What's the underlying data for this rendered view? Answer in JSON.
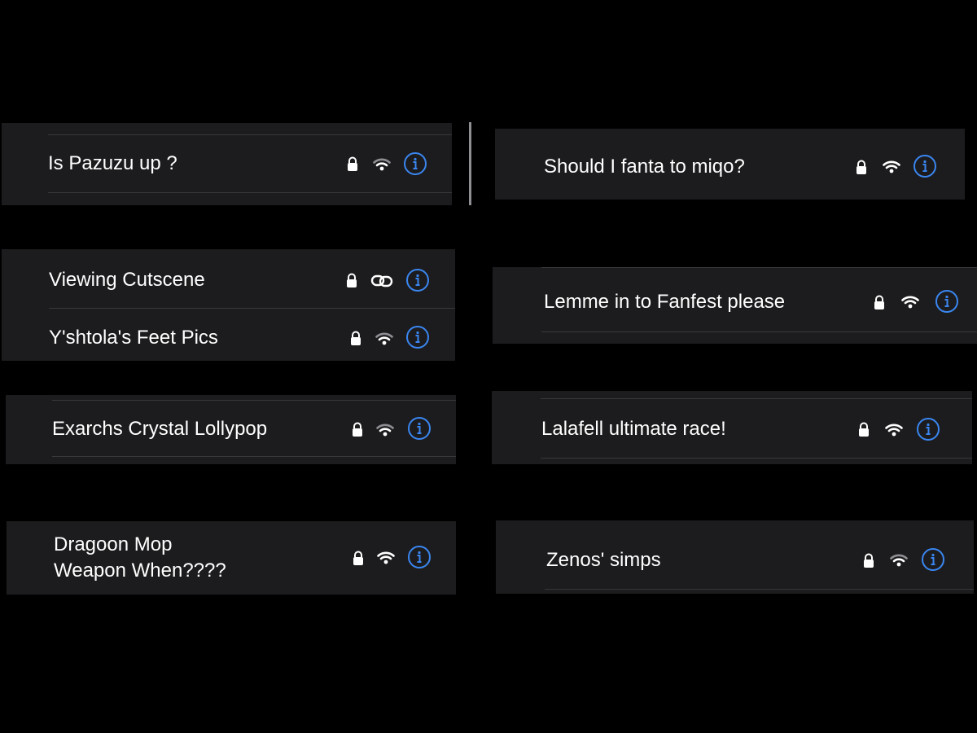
{
  "colors": {
    "panel": "#1c1c1e",
    "separator": "#38383a",
    "accent": "#3a86f0",
    "text": "#ffffff"
  },
  "networks": {
    "pazuzu": {
      "name": "Is Pazuzu up ?",
      "icons": [
        "lock-icon",
        "wifi-icon",
        "info-icon"
      ]
    },
    "fanta": {
      "name": "Should I fanta to miqo?",
      "icons": [
        "lock-icon",
        "wifi-icon",
        "info-icon"
      ]
    },
    "cutscene": {
      "name": "Viewing Cutscene",
      "icons": [
        "lock-icon",
        "link-icon",
        "info-icon"
      ]
    },
    "feet": {
      "name": "Y'shtola's Feet Pics",
      "icons": [
        "lock-icon",
        "wifi-icon",
        "info-icon"
      ]
    },
    "fanfest": {
      "name": "Lemme in to Fanfest please",
      "icons": [
        "lock-icon",
        "wifi-icon",
        "info-icon"
      ]
    },
    "lollypop": {
      "name": "Exarchs Crystal Lollypop",
      "icons": [
        "lock-icon",
        "wifi-icon",
        "info-icon"
      ]
    },
    "lalafell": {
      "name": "Lalafell ultimate race!",
      "icons": [
        "lock-icon",
        "wifi-icon",
        "info-icon"
      ]
    },
    "dragoon": {
      "name": "Dragoon Mop\nWeapon When????",
      "icons": [
        "lock-icon",
        "wifi-icon",
        "info-icon"
      ]
    },
    "zenos": {
      "name": "Zenos' simps",
      "icons": [
        "lock-icon",
        "wifi-icon",
        "info-icon"
      ]
    }
  }
}
